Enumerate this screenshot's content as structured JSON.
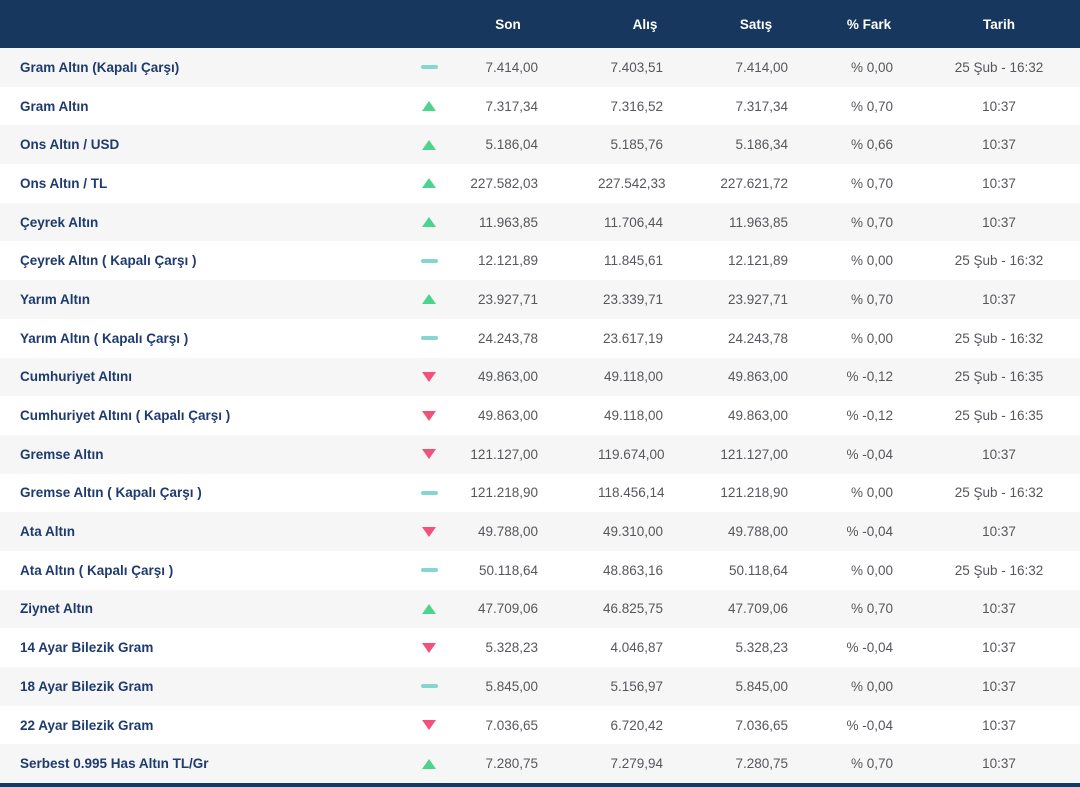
{
  "colors": {
    "header_bg": "#17375f",
    "row_alt": "#f6f6f6",
    "name_text": "#1e3a6e",
    "value_text": "#55575c",
    "up": "#4ed38f",
    "down": "#f2517a",
    "flat": "#85d6d0"
  },
  "table": {
    "headers": {
      "son": "Son",
      "alis": "Alış",
      "satis": "Satış",
      "fark": "% Fark",
      "tarih": "Tarih"
    },
    "rows": [
      {
        "name": "Gram Altın (Kapalı Çarşı)",
        "trend": "flat",
        "son": "7.414,00",
        "alis": "7.403,51",
        "satis": "7.414,00",
        "fark": "% 0,00",
        "tarih": "25 Şub - 16:32"
      },
      {
        "name": "Gram Altın",
        "trend": "up",
        "son": "7.317,34",
        "alis": "7.316,52",
        "satis": "7.317,34",
        "fark": "% 0,70",
        "tarih": "10:37"
      },
      {
        "name": "Ons Altın / USD",
        "trend": "up",
        "son": "5.186,04",
        "alis": "5.185,76",
        "satis": "5.186,34",
        "fark": "% 0,66",
        "tarih": "10:37"
      },
      {
        "name": "Ons Altın / TL",
        "trend": "up",
        "son": "227.582,03",
        "alis": "227.542,33",
        "satis": "227.621,72",
        "fark": "% 0,70",
        "tarih": "10:37"
      },
      {
        "name": "Çeyrek Altın",
        "trend": "up",
        "son": "11.963,85",
        "alis": "11.706,44",
        "satis": "11.963,85",
        "fark": "% 0,70",
        "tarih": "10:37"
      },
      {
        "name": "Çeyrek Altın ( Kapalı Çarşı )",
        "trend": "flat",
        "son": "12.121,89",
        "alis": "11.845,61",
        "satis": "12.121,89",
        "fark": "% 0,00",
        "tarih": "25 Şub - 16:32"
      },
      {
        "name": "Yarım Altın",
        "trend": "up",
        "son": "23.927,71",
        "alis": "23.339,71",
        "satis": "23.927,71",
        "fark": "% 0,70",
        "tarih": "10:37"
      },
      {
        "name": "Yarım Altın ( Kapalı Çarşı )",
        "trend": "flat",
        "son": "24.243,78",
        "alis": "23.617,19",
        "satis": "24.243,78",
        "fark": "% 0,00",
        "tarih": "25 Şub - 16:32"
      },
      {
        "name": "Cumhuriyet Altını",
        "trend": "down",
        "son": "49.863,00",
        "alis": "49.118,00",
        "satis": "49.863,00",
        "fark": "% -0,12",
        "tarih": "25 Şub - 16:35"
      },
      {
        "name": "Cumhuriyet Altını ( Kapalı Çarşı )",
        "trend": "down",
        "son": "49.863,00",
        "alis": "49.118,00",
        "satis": "49.863,00",
        "fark": "% -0,12",
        "tarih": "25 Şub - 16:35"
      },
      {
        "name": "Gremse Altın",
        "trend": "down",
        "son": "121.127,00",
        "alis": "119.674,00",
        "satis": "121.127,00",
        "fark": "% -0,04",
        "tarih": "10:37"
      },
      {
        "name": "Gremse Altın ( Kapalı Çarşı )",
        "trend": "flat",
        "son": "121.218,90",
        "alis": "118.456,14",
        "satis": "121.218,90",
        "fark": "% 0,00",
        "tarih": "25 Şub - 16:32"
      },
      {
        "name": "Ata Altın",
        "trend": "down",
        "son": "49.788,00",
        "alis": "49.310,00",
        "satis": "49.788,00",
        "fark": "% -0,04",
        "tarih": "10:37"
      },
      {
        "name": "Ata Altın ( Kapalı Çarşı )",
        "trend": "flat",
        "son": "50.118,64",
        "alis": "48.863,16",
        "satis": "50.118,64",
        "fark": "% 0,00",
        "tarih": "25 Şub - 16:32"
      },
      {
        "name": "Ziynet Altın",
        "trend": "up",
        "son": "47.709,06",
        "alis": "46.825,75",
        "satis": "47.709,06",
        "fark": "% 0,70",
        "tarih": "10:37"
      },
      {
        "name": "14 Ayar Bilezik Gram",
        "trend": "down",
        "son": "5.328,23",
        "alis": "4.046,87",
        "satis": "5.328,23",
        "fark": "% -0,04",
        "tarih": "10:37"
      },
      {
        "name": "18 Ayar Bilezik Gram",
        "trend": "flat",
        "son": "5.845,00",
        "alis": "5.156,97",
        "satis": "5.845,00",
        "fark": "% 0,00",
        "tarih": "10:37"
      },
      {
        "name": "22 Ayar Bilezik Gram",
        "trend": "down",
        "son": "7.036,65",
        "alis": "6.720,42",
        "satis": "7.036,65",
        "fark": "% -0,04",
        "tarih": "10:37"
      },
      {
        "name": "Serbest 0.995 Has Altın TL/Gr",
        "trend": "up",
        "son": "7.280,75",
        "alis": "7.279,94",
        "satis": "7.280,75",
        "fark": "% 0,70",
        "tarih": "10:37"
      }
    ]
  }
}
